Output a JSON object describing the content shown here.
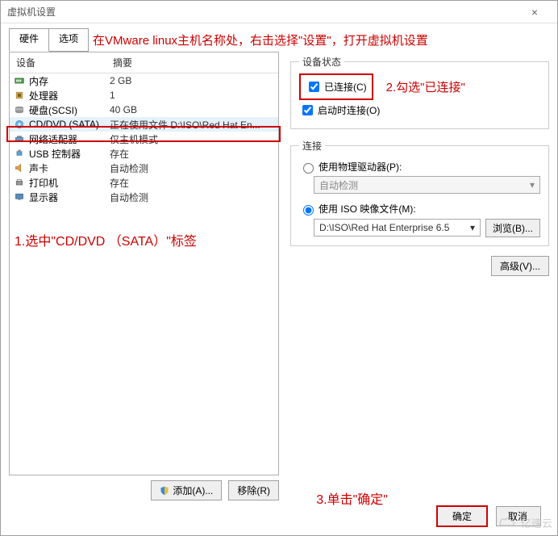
{
  "window": {
    "title": "虚拟机设置",
    "close_icon": "×"
  },
  "tabs": {
    "hardware": "硬件",
    "options": "选项"
  },
  "annotation_top": "在VMware linux主机名称处，右击选择\"设置\"，打开虚拟机设置",
  "headers": {
    "device": "设备",
    "summary": "摘要"
  },
  "devices": [
    {
      "name": "内存",
      "summary": "2 GB",
      "icon": "memory-icon"
    },
    {
      "name": "处理器",
      "summary": "1",
      "icon": "cpu-icon"
    },
    {
      "name": "硬盘(SCSI)",
      "summary": "40 GB",
      "icon": "disk-icon"
    },
    {
      "name": "CD/DVD (SATA)",
      "summary": "正在使用文件 D:\\ISO\\Red Hat En...",
      "icon": "cd-icon",
      "selected": true
    },
    {
      "name": "网络适配器",
      "summary": "仅主机模式",
      "icon": "network-icon"
    },
    {
      "name": "USB 控制器",
      "summary": "存在",
      "icon": "usb-icon"
    },
    {
      "name": "声卡",
      "summary": "自动检测",
      "icon": "sound-icon"
    },
    {
      "name": "打印机",
      "summary": "存在",
      "icon": "printer-icon"
    },
    {
      "name": "显示器",
      "summary": "自动检测",
      "icon": "display-icon"
    }
  ],
  "annotation_left": "1.选中\"CD/DVD （SATA）\"标签",
  "left_buttons": {
    "add": "添加(A)...",
    "remove": "移除(R)"
  },
  "device_state": {
    "legend": "设备状态",
    "connected": "已连接(C)",
    "connect_on_start": "启动时连接(O)",
    "note": "2.勾选\"已连接\""
  },
  "connection": {
    "legend": "连接",
    "use_physical": "使用物理驱动器(P):",
    "auto_detect": "自动检测",
    "use_iso": "使用 ISO 映像文件(M):",
    "iso_path": "D:\\ISO\\Red Hat Enterprise 6.5",
    "browse": "浏览(B)...",
    "advanced": "高级(V)..."
  },
  "annotation_footer": "3.单击\"确定\"",
  "footer": {
    "ok": "确定",
    "cancel": "取消"
  },
  "watermark": "亿速云"
}
